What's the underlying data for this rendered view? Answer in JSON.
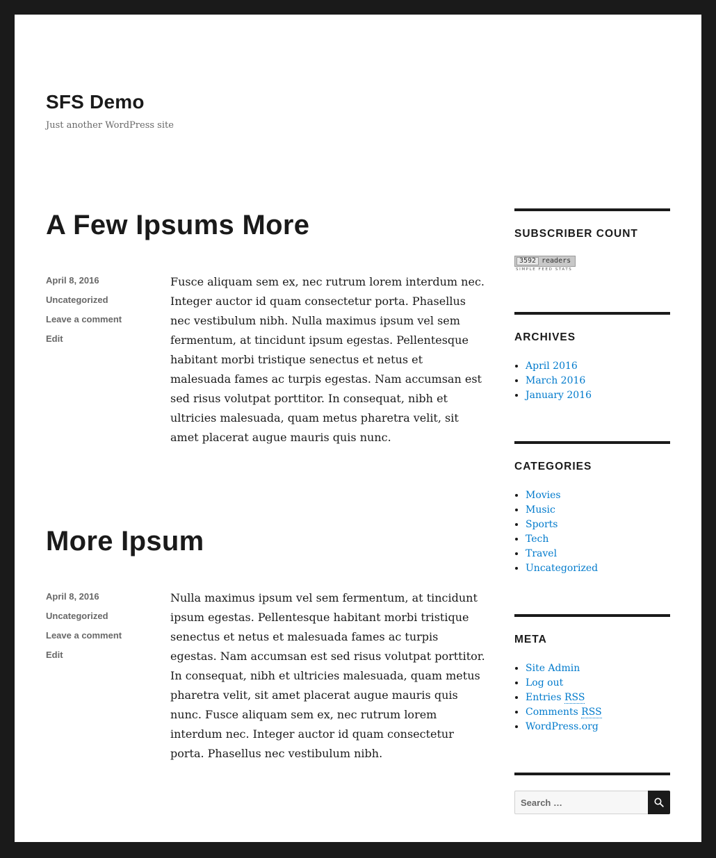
{
  "site": {
    "title": "SFS Demo",
    "description": "Just another WordPress site"
  },
  "posts": [
    {
      "title": "A Few Ipsums More",
      "date": "April 8, 2016",
      "category": "Uncategorized",
      "comment_link": "Leave a comment",
      "edit_link": "Edit",
      "content": "Fusce aliquam sem ex, nec rutrum lorem interdum nec. Integer auctor id quam consectetur porta. Phasellus nec vestibulum nibh. Nulla maximus ipsum vel sem fermentum, at tincidunt ipsum egestas. Pellentesque habitant morbi tristique senectus et netus et malesuada fames ac turpis egestas. Nam accumsan est sed risus volutpat porttitor. In consequat, nibh et ultricies malesuada, quam metus pharetra velit, sit amet placerat augue mauris quis nunc."
    },
    {
      "title": "More Ipsum",
      "date": "April 8, 2016",
      "category": "Uncategorized",
      "comment_link": "Leave a comment",
      "edit_link": "Edit",
      "content": "Nulla maximus ipsum vel sem fermentum, at tincidunt ipsum egestas. Pellentesque habitant morbi tristique senectus et netus et malesuada fames ac turpis egestas. Nam accumsan est sed risus volutpat porttitor. In consequat, nibh et ultricies malesuada, quam metus pharetra velit, sit amet placerat augue mauris quis nunc. Fusce aliquam sem ex, nec rutrum lorem interdum nec. Integer auctor id quam consectetur porta. Phasellus nec vestibulum nibh."
    }
  ],
  "sidebar": {
    "subscriber_count": {
      "title": "SUBSCRIBER COUNT",
      "count": "3592",
      "unit": "readers",
      "caption": "SIMPLE FEED STATS"
    },
    "archives": {
      "title": "ARCHIVES",
      "items": [
        "April 2016",
        "March 2016",
        "January 2016"
      ]
    },
    "categories": {
      "title": "CATEGORIES",
      "items": [
        "Movies",
        "Music",
        "Sports",
        "Tech",
        "Travel",
        "Uncategorized"
      ]
    },
    "meta": {
      "title": "META",
      "items": [
        {
          "pre": "Site Admin",
          "abbr": ""
        },
        {
          "pre": "Log out",
          "abbr": ""
        },
        {
          "pre": "Entries ",
          "abbr": "RSS"
        },
        {
          "pre": "Comments ",
          "abbr": "RSS"
        },
        {
          "pre": "WordPress.org",
          "abbr": ""
        }
      ]
    },
    "search": {
      "placeholder": "Search …",
      "icon": "search-icon"
    }
  },
  "colors": {
    "frame": "#1a1a1a",
    "text": "#1a1a1a",
    "muted": "#686868",
    "link": "#007acc"
  }
}
